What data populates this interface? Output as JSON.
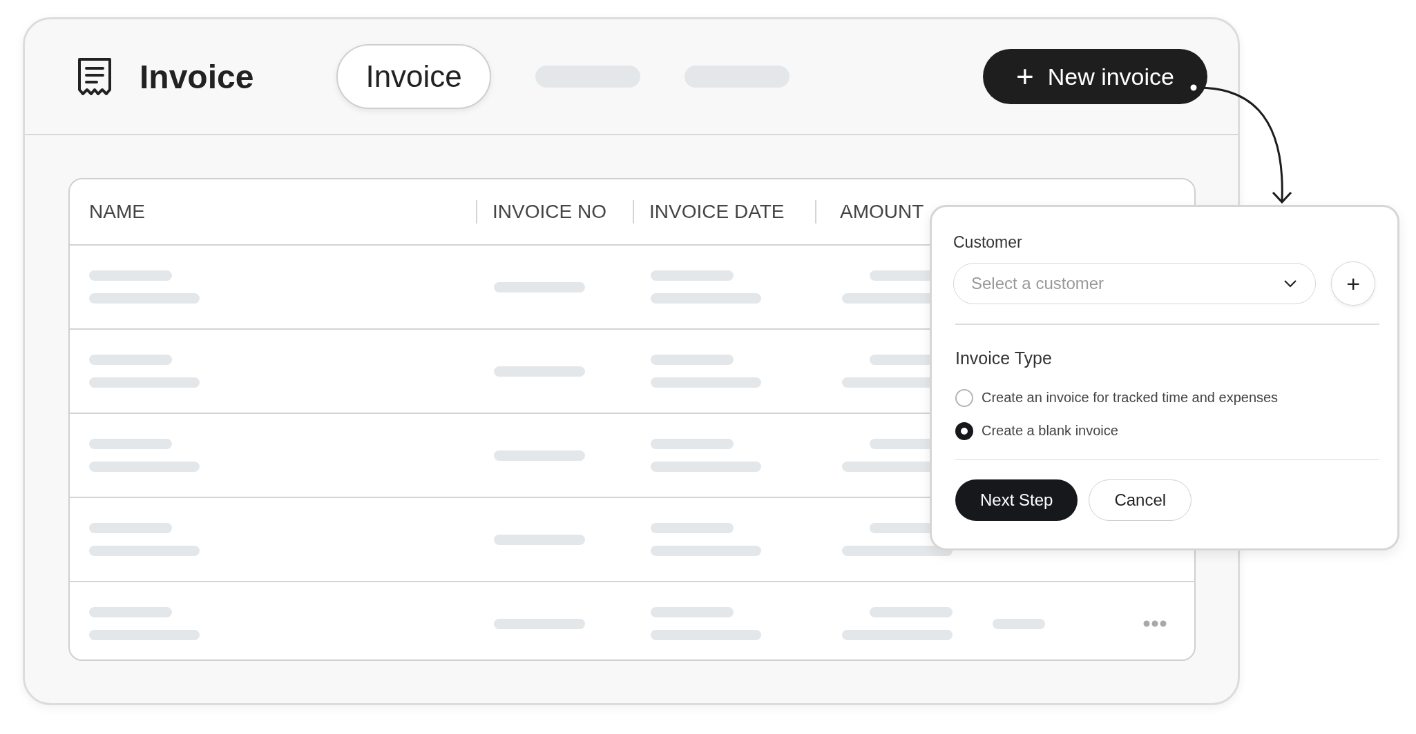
{
  "header": {
    "title": "Invoice",
    "tabs": [
      {
        "label": "Invoice",
        "selected": true
      }
    ],
    "new_button": {
      "icon": "+",
      "label": "New invoice"
    }
  },
  "table": {
    "columns": [
      "NAME",
      "INVOICE NO",
      "INVOICE DATE",
      "AMOUNT"
    ]
  },
  "popup": {
    "customer_label": "Customer",
    "customer_select": {
      "placeholder": "Select a customer"
    },
    "add_button": "+",
    "type_label": "Invoice Type",
    "options": [
      {
        "label": "Create an invoice for tracked time and expenses",
        "selected": false
      },
      {
        "label": "Create a blank invoice",
        "selected": true
      }
    ],
    "buttons": [
      {
        "kind": "primary",
        "label": "Next Step"
      },
      {
        "kind": "secondary",
        "label": "Cancel"
      }
    ]
  }
}
